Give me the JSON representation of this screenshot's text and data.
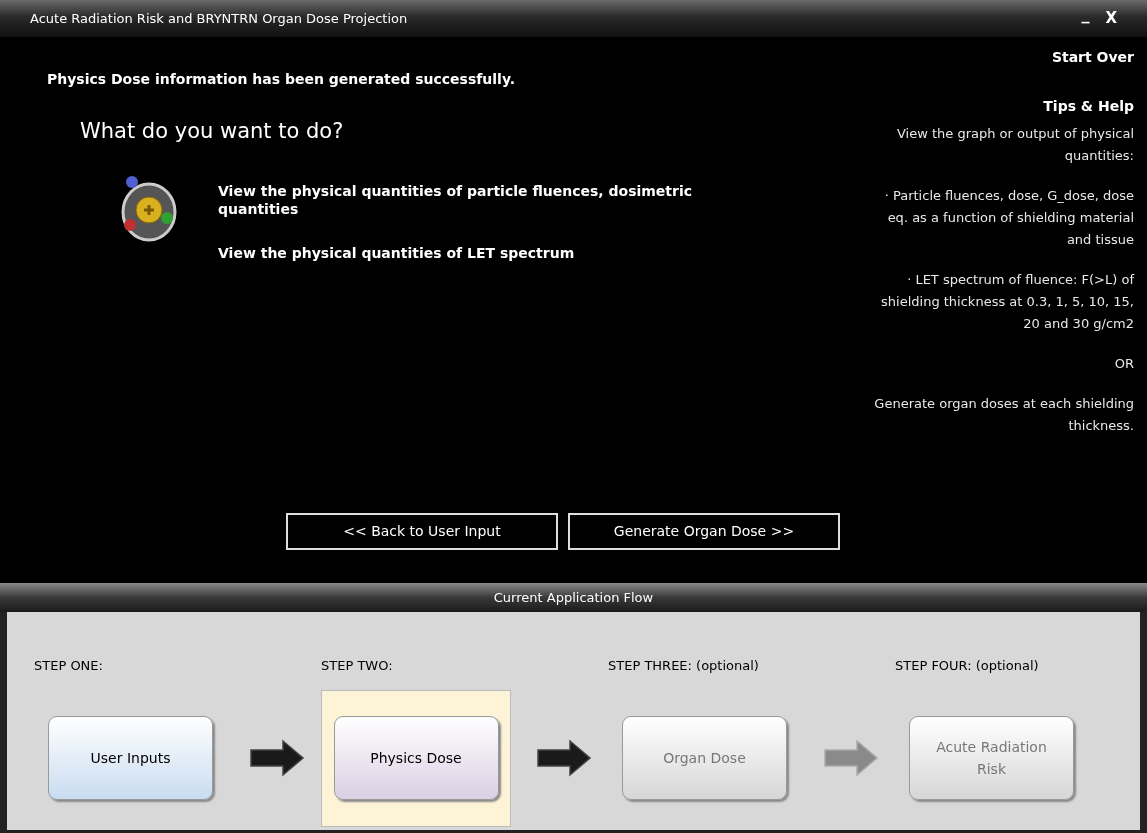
{
  "window": {
    "title": "Acute Radiation Risk and BRYNTRN  Organ Dose Projection",
    "minimize": "_",
    "close": "X"
  },
  "message": "Physics Dose information has been generated successfully.",
  "prompt": "What do you want to do?",
  "options": [
    "View the physical quantities of particle fluences, dosimetric quantities",
    "View the physical quantities of LET spectrum"
  ],
  "buttons": [
    "<< Back to User Input",
    "Generate Organ Dose >>"
  ],
  "sidebar": {
    "start_over": "Start Over",
    "tips_title": "Tips & Help",
    "tips": [
      "View the graph or output of physical quantities:",
      "· Particle fluences, dose, G_dose, dose eq. as a function of shielding material and tissue",
      "· LET spectrum of fluence: F(>L) of shielding thickness at 0.3, 1, 5, 10, 15, 20 and 30 g/cm2",
      "OR",
      "Generate organ doses at each shielding thickness."
    ]
  },
  "flow": {
    "title": "Current Application Flow",
    "steps": [
      {
        "label": "STEP ONE:",
        "button": "User Inputs",
        "selected": false,
        "disabled": false,
        "color": "#c9dcf0"
      },
      {
        "label": "STEP TWO:",
        "button": "Physics Dose",
        "selected": true,
        "disabled": false,
        "color": "#dccfe4",
        "arrow_disabled": false
      },
      {
        "label": "STEP THREE: (optional)",
        "button": "Organ Dose",
        "selected": false,
        "disabled": true,
        "color": "#d6d6d6",
        "arrow_disabled": false
      },
      {
        "label": "STEP FOUR: (optional)",
        "button": "Acute Radiation Risk",
        "selected": false,
        "disabled": true,
        "color": "#d6d6d6",
        "arrow_disabled": true
      }
    ]
  }
}
